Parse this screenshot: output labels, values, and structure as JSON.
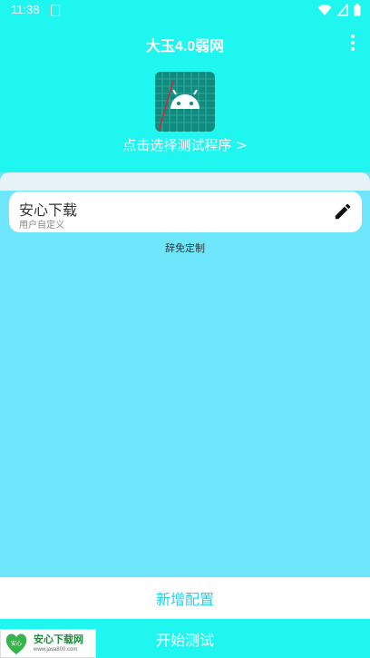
{
  "status_bar": {
    "time": "11:38"
  },
  "app_bar": {
    "title": "大玉4.0弱网"
  },
  "program_picker": {
    "label": "点击选择测试程序 >"
  },
  "config_list": [
    {
      "name": "安心下载",
      "type": "用户自定义"
    }
  ],
  "credit": "辞免定制",
  "bottom": {
    "add_config": "新增配置",
    "start_test": "开始测试"
  },
  "watermark": {
    "title": "安心下载网",
    "url": "www.java800.com",
    "logo_text": "安心"
  },
  "colors": {
    "primary": "#1ff6f0",
    "background": "#6ee6fb",
    "accent_text": "#1fd4e8"
  }
}
